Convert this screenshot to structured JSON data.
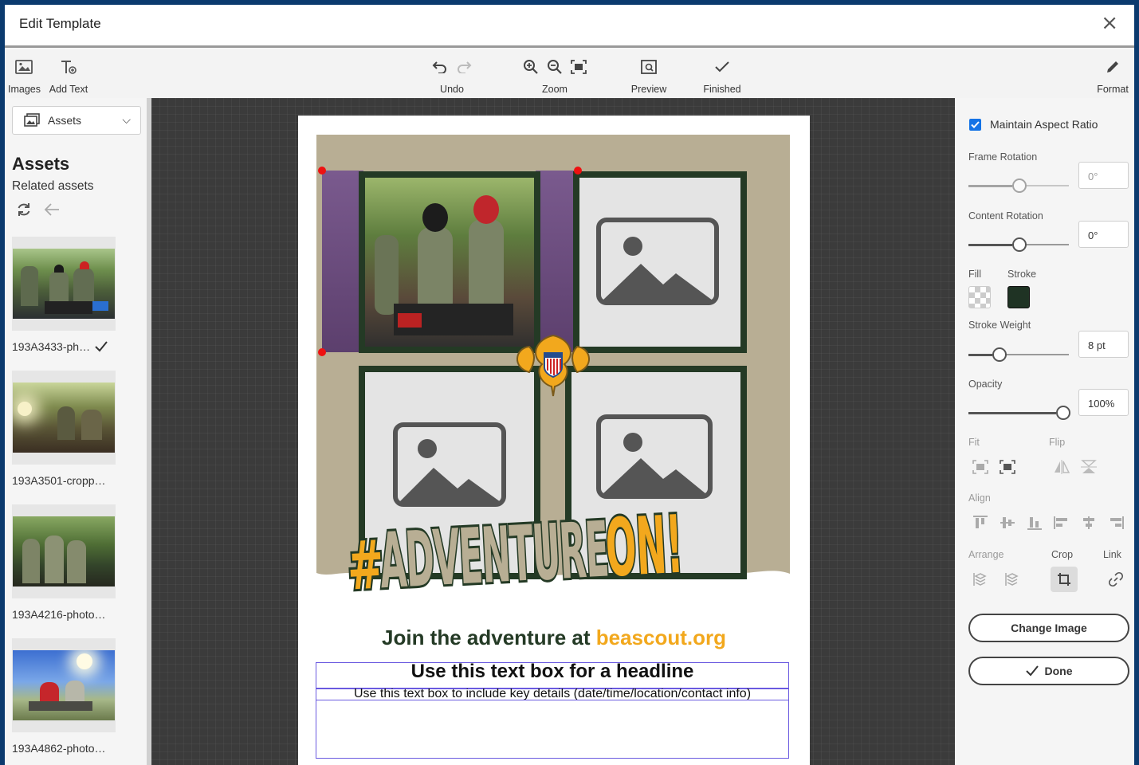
{
  "window": {
    "title": "Edit Template",
    "close_glyph": "×"
  },
  "toolbar": {
    "images": "Images",
    "add_text": "Add Text",
    "undo": "Undo",
    "zoom": "Zoom",
    "preview": "Preview",
    "finished": "Finished",
    "format": "Format"
  },
  "left_panel": {
    "source_select": "Assets",
    "heading": "Assets",
    "subheading": "Related assets",
    "assets": [
      {
        "name": "193A3433-ph…",
        "selected": true
      },
      {
        "name": "193A3501-cropp…",
        "selected": false
      },
      {
        "name": "193A4216-photo…",
        "selected": false
      },
      {
        "name": "193A4862-photo…",
        "selected": false
      }
    ]
  },
  "canvas": {
    "tagline_prefix": "Join the adventure at ",
    "tagline_link": "beascout.org",
    "headline": "Use this text box for a headline",
    "details": "Use this text box to include key details (date/time/location/contact info)",
    "logo_text_hash": "#",
    "logo_text_main": "ADVENTURE",
    "logo_text_on": "ON!"
  },
  "right_panel": {
    "maintain_aspect": "Maintain Aspect Ratio",
    "frame_rotation": "Frame Rotation",
    "frame_rotation_value": "0°",
    "content_rotation": "Content Rotation",
    "content_rotation_value": "0°",
    "fill": "Fill",
    "stroke": "Stroke",
    "stroke_color": "#1f3324",
    "stroke_weight": "Stroke Weight",
    "stroke_weight_value": "8 pt",
    "opacity": "Opacity",
    "opacity_value": "100%",
    "fit": "Fit",
    "flip": "Flip",
    "align": "Align",
    "arrange": "Arrange",
    "crop": "Crop",
    "link": "Link",
    "change_image": "Change Image",
    "done": "Done"
  },
  "colors": {
    "accent": "#1473e6",
    "brand_dark_green": "#243a25",
    "brand_gold": "#f2a81d",
    "brand_khaki": "#b8ae94",
    "background": "#0b3a6e"
  }
}
